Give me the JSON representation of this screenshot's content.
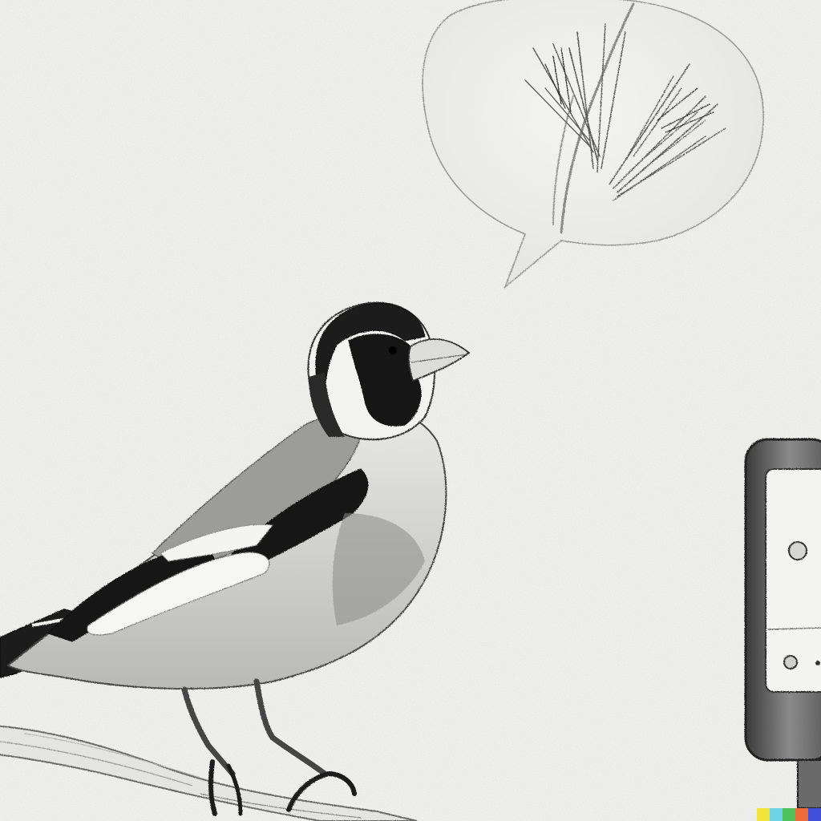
{
  "scene": {
    "subject": "pencil-sketch-goldfinch",
    "elements": [
      "goldfinch",
      "branch",
      "speech-bubble",
      "leaf-sprig",
      "phone-device"
    ]
  },
  "colors": {
    "paper": "#f9f9f7",
    "graphite_dark": "#1a1a1a",
    "graphite_mid": "#6a6a6a",
    "graphite_light": "#bdbdbd",
    "watermark": [
      "#f2e33a",
      "#6fd3e8",
      "#4fc35a",
      "#ef6b3a",
      "#3f4fd8"
    ]
  }
}
